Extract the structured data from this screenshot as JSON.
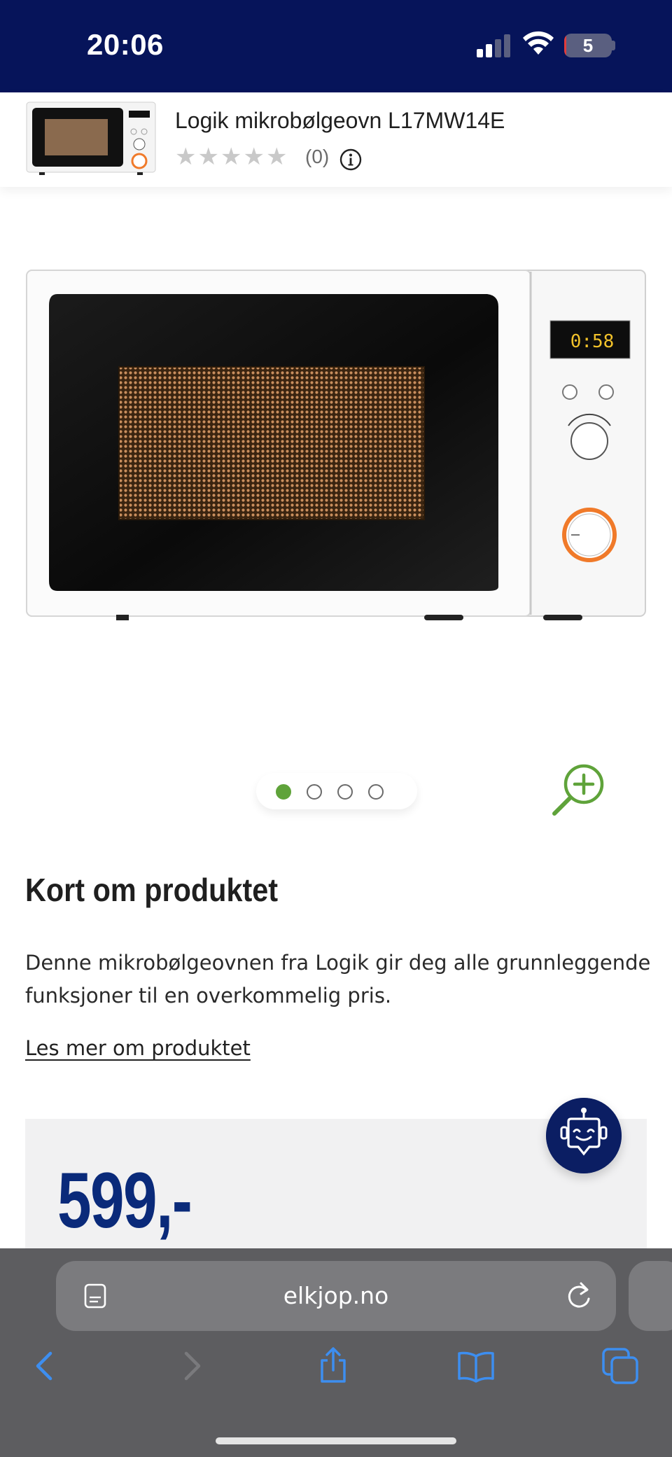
{
  "status_bar": {
    "time": "20:06",
    "battery_level": "5",
    "battery_fraction": 0.05,
    "icons": [
      "cellular-signal-icon",
      "wifi-icon",
      "battery-icon"
    ]
  },
  "product_header": {
    "title": "Logik mikrobølgeovn L17MW14E",
    "rating_stars": 0,
    "review_count": "(0)"
  },
  "microwave_display": "0:58",
  "carousel": {
    "total": 4,
    "active_index": 0
  },
  "description": {
    "heading": "Kort om produktet",
    "text": "Denne mikrobølgeovnen fra Logik gir deg alle grunnleggende funksjoner til en overkommelig pris.",
    "read_more": "Les mer om produktet"
  },
  "price": {
    "value": "599,-"
  },
  "browser": {
    "url": "elkjop.no"
  },
  "colors": {
    "status_bar_bg": "#06145a",
    "price": "#0a2a7a",
    "accent_green": "#5fa33a",
    "chat_button": "#0b1e63",
    "browser_blue": "#3d8ef0"
  }
}
